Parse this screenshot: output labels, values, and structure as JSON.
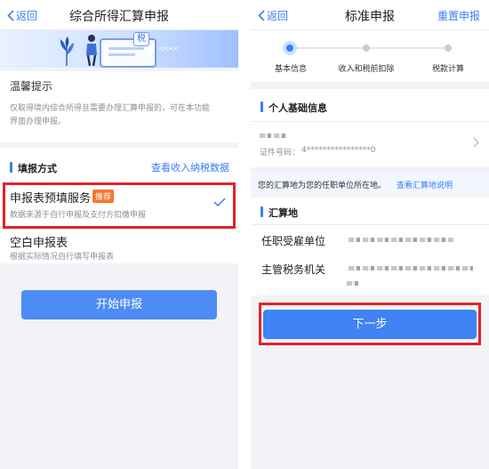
{
  "left": {
    "nav": {
      "back_label": "返回",
      "title": "综合所得汇算申报"
    },
    "banner": {
      "badge_text": "税",
      "arrows_text": "<<<<"
    },
    "tip": {
      "title": "温馨提示",
      "body_line1": "仅取得境内综合所得且需要办理汇算申报的，可在本功能",
      "body_line2": "界面办理申报。"
    },
    "method": {
      "section_title": "填报方式",
      "view_link": "查看收入纳税数据",
      "options": [
        {
          "title": "申报表预填服务",
          "badge": "推荐",
          "desc": "数据来源于自行申报及支付方扣缴申报",
          "selected": true
        },
        {
          "title": "空白申报表",
          "badge": "",
          "desc": "根据实际情况自行填写申报表",
          "selected": false
        }
      ]
    },
    "start_button": "开始申报"
  },
  "right": {
    "nav": {
      "back_label": "返回",
      "title": "标准申报",
      "action": "重置申报"
    },
    "steps": [
      {
        "label": "基本信息",
        "active": true
      },
      {
        "label": "收入和税前扣除",
        "active": false
      },
      {
        "label": "税款计算",
        "active": false
      }
    ],
    "personal": {
      "section_title": "个人基础信息",
      "id_label": "证件号码：",
      "id_value": "4****************0"
    },
    "notice": {
      "text": "您的汇算地为您的任职单位所在地。",
      "link": "查看汇算地说明"
    },
    "settlement": {
      "section_title": "汇算地",
      "employer_label": "任职受雇单位",
      "tax_office_label": "主管税务机关"
    },
    "next_button": "下一步"
  },
  "colors": {
    "accent": "#3b7cf6",
    "button": "#4d8cf5",
    "highlight": "#e2232a",
    "badge": "#f5772f"
  }
}
